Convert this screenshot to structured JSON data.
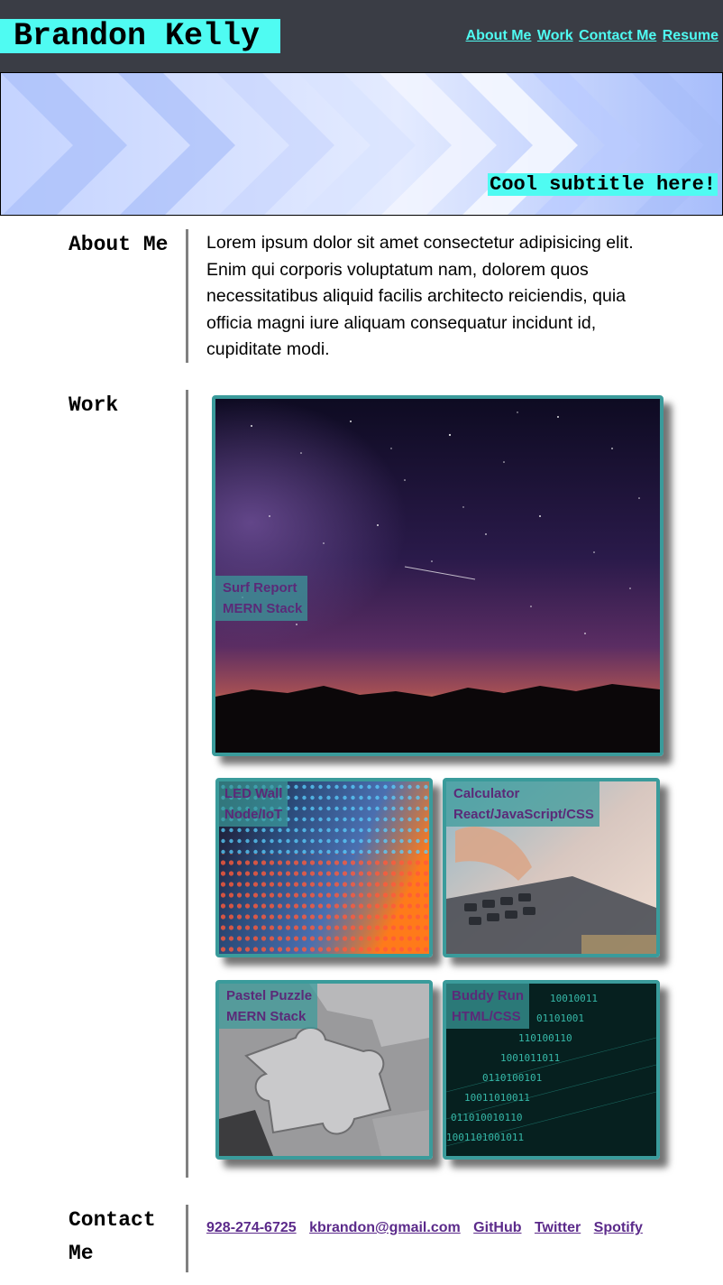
{
  "header": {
    "site_name": "Brandon Kelly",
    "nav": [
      "About Me",
      "Work",
      "Contact Me",
      "Resume"
    ]
  },
  "hero": {
    "subtitle": "Cool subtitle here!"
  },
  "about": {
    "title": "About Me",
    "text": "Lorem ipsum dolor sit amet consectetur adipisicing elit. Enim qui corporis voluptatum nam, dolorem quos necessitatibus aliquid facilis architecto reiciendis, quia officia magni iure aliquam consequatur incidunt id, cupiditate modi."
  },
  "work": {
    "title": "Work",
    "projects": [
      {
        "name": "Surf Report",
        "stack": "MERN Stack"
      },
      {
        "name": "LED Wall",
        "stack": "Node/IoT"
      },
      {
        "name": "Calculator",
        "stack": "React/JavaScript/CSS"
      },
      {
        "name": "Pastel Puzzle",
        "stack": "MERN Stack"
      },
      {
        "name": "Buddy Run",
        "stack": "HTML/CSS"
      }
    ]
  },
  "contact": {
    "title": "Contact Me",
    "links": [
      "928-274-6725",
      "kbrandon@gmail.com",
      "GitHub",
      "Twitter",
      "Spotify"
    ]
  },
  "colors": {
    "accent": "#4ffbf2",
    "header_bg": "#3a3d45",
    "card_border": "#3a9b9b",
    "link": "#5b2a8a"
  }
}
